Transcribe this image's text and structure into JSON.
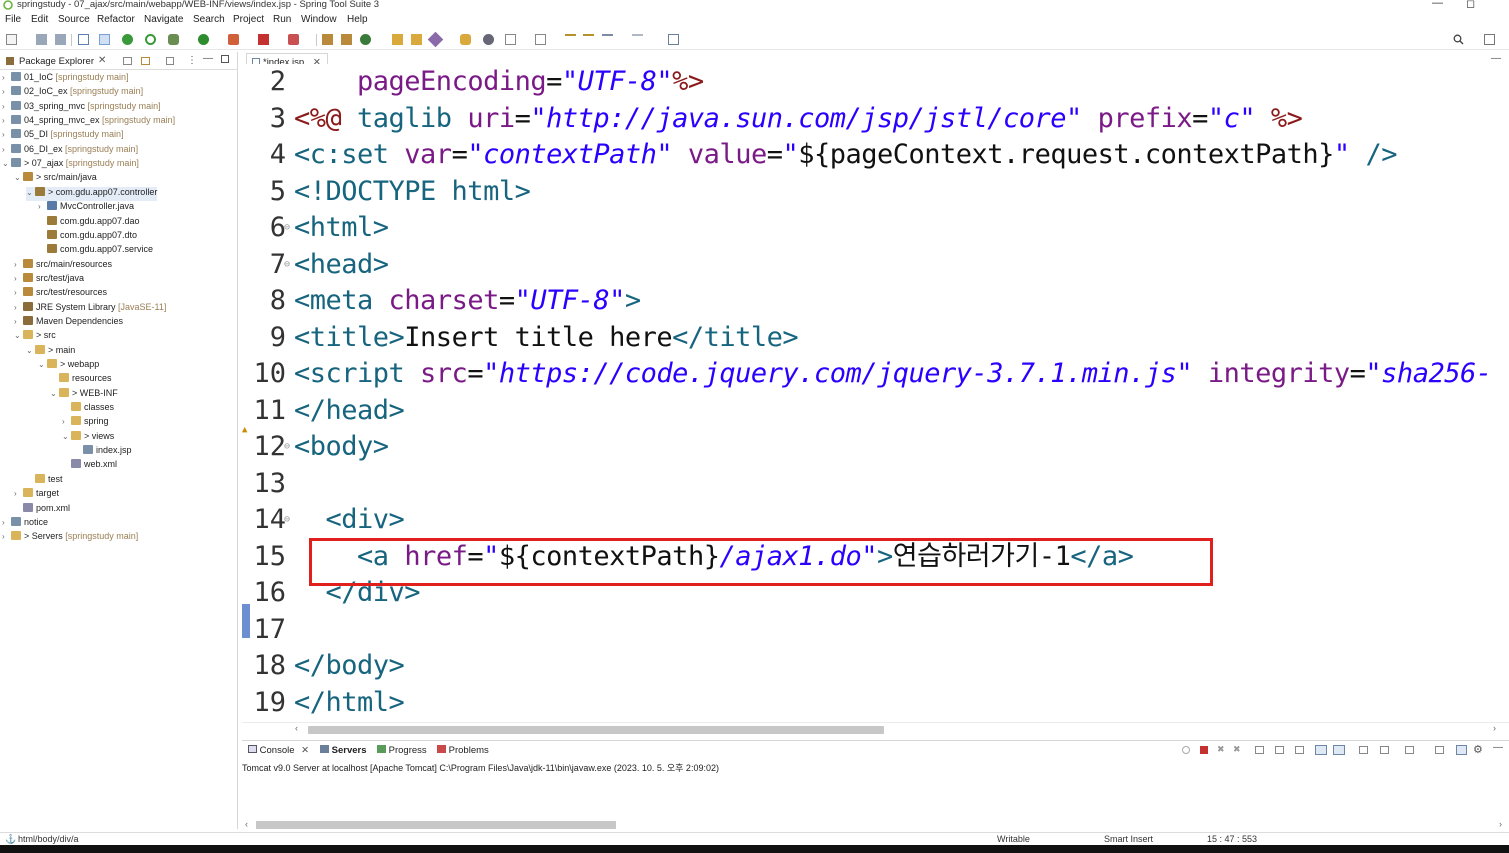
{
  "window": {
    "title": "springstudy - 07_ajax/src/main/webapp/WEB-INF/views/index.jsp - Spring Tool Suite 3",
    "minimize": "—",
    "maximize": "◻"
  },
  "menu": [
    "File",
    "Edit",
    "Source",
    "Refactor",
    "Navigate",
    "Search",
    "Project",
    "Run",
    "Window",
    "Help"
  ],
  "explorer": {
    "title": "Package Explorer",
    "close": "✕",
    "items": [
      {
        "label": "01_IoC",
        "meta": "[springstudy main]",
        "icon": "project-icon"
      },
      {
        "label": "02_IoC_ex",
        "meta": "[springstudy main]",
        "icon": "project-icon"
      },
      {
        "label": "03_spring_mvc",
        "meta": "[springstudy main]",
        "icon": "project-icon"
      },
      {
        "label": "04_spring_mvc_ex",
        "meta": "[springstudy main]",
        "icon": "project-icon"
      },
      {
        "label": "05_DI",
        "meta": "[springstudy main]",
        "icon": "project-icon"
      },
      {
        "label": "06_DI_ex",
        "meta": "[springstudy main]",
        "icon": "project-icon"
      },
      {
        "label": "> 07_ajax",
        "meta": "[springstudy main]",
        "icon": "project-icon"
      },
      {
        "label": "> src/main/java",
        "meta": "",
        "icon": "source-folder-icon"
      },
      {
        "label": "> com.gdu.app07.controller",
        "meta": "",
        "icon": "package-icon"
      },
      {
        "label": "MvcController.java",
        "meta": "",
        "icon": "java-file-icon"
      },
      {
        "label": "com.gdu.app07.dao",
        "meta": "",
        "icon": "package-icon"
      },
      {
        "label": "com.gdu.app07.dto",
        "meta": "",
        "icon": "package-icon"
      },
      {
        "label": "com.gdu.app07.service",
        "meta": "",
        "icon": "package-icon"
      },
      {
        "label": "src/main/resources",
        "meta": "",
        "icon": "source-folder-icon"
      },
      {
        "label": "src/test/java",
        "meta": "",
        "icon": "source-folder-icon"
      },
      {
        "label": "src/test/resources",
        "meta": "",
        "icon": "source-folder-icon"
      },
      {
        "label": "JRE System Library",
        "meta": "[JavaSE-11]",
        "icon": "library-icon"
      },
      {
        "label": "Maven Dependencies",
        "meta": "",
        "icon": "library-icon"
      },
      {
        "label": "> src",
        "meta": "",
        "icon": "folder-icon"
      },
      {
        "label": "> main",
        "meta": "",
        "icon": "folder-icon"
      },
      {
        "label": "> webapp",
        "meta": "",
        "icon": "folder-icon"
      },
      {
        "label": "resources",
        "meta": "",
        "icon": "folder-icon"
      },
      {
        "label": "> WEB-INF",
        "meta": "",
        "icon": "folder-icon"
      },
      {
        "label": "classes",
        "meta": "",
        "icon": "folder-icon"
      },
      {
        "label": "spring",
        "meta": "",
        "icon": "folder-icon"
      },
      {
        "label": "> views",
        "meta": "",
        "icon": "folder-icon"
      },
      {
        "label": "index.jsp",
        "meta": "",
        "icon": "jsp-file-icon"
      },
      {
        "label": "web.xml",
        "meta": "",
        "icon": "xml-file-icon"
      },
      {
        "label": "test",
        "meta": "",
        "icon": "folder-icon"
      },
      {
        "label": "target",
        "meta": "",
        "icon": "folder-icon"
      },
      {
        "label": "pom.xml",
        "meta": "",
        "icon": "xml-file-icon"
      },
      {
        "label": "notice",
        "meta": "",
        "icon": "project-icon"
      },
      {
        "label": "> Servers",
        "meta": "[springstudy main]",
        "icon": "folder-icon"
      }
    ]
  },
  "editor": {
    "tab_label": "*index.jsp",
    "tab_close": "✕",
    "lines": [
      {
        "num": "2",
        "parts": [
          {
            "t": "    ",
            "c": "plain"
          },
          {
            "t": "pageEncoding",
            "c": "attr"
          },
          {
            "t": "=",
            "c": "plain"
          },
          {
            "t": "\"UTF-8\"",
            "c": "str"
          },
          {
            "t": "%>",
            "c": "dir"
          }
        ]
      },
      {
        "num": "3",
        "parts": [
          {
            "t": "<%@ ",
            "c": "dir"
          },
          {
            "t": "taglib ",
            "c": "tag"
          },
          {
            "t": "uri",
            "c": "attr"
          },
          {
            "t": "=",
            "c": "plain"
          },
          {
            "t": "\"http://java.sun.com/jsp/jstl/core\" ",
            "c": "str"
          },
          {
            "t": "prefix",
            "c": "attr"
          },
          {
            "t": "=",
            "c": "plain"
          },
          {
            "t": "\"c\" ",
            "c": "str"
          },
          {
            "t": "%>",
            "c": "dir"
          }
        ]
      },
      {
        "num": "4",
        "parts": [
          {
            "t": "<c:set ",
            "c": "tag"
          },
          {
            "t": "var",
            "c": "attr"
          },
          {
            "t": "=",
            "c": "plain"
          },
          {
            "t": "\"contextPath\" ",
            "c": "str"
          },
          {
            "t": "value",
            "c": "attr"
          },
          {
            "t": "=",
            "c": "plain"
          },
          {
            "t": "\"",
            "c": "str"
          },
          {
            "t": "${pageContext.request.contextPath}",
            "c": "plain"
          },
          {
            "t": "\" ",
            "c": "str"
          },
          {
            "t": "/>",
            "c": "tag"
          }
        ]
      },
      {
        "num": "5",
        "parts": [
          {
            "t": "<!DOCTYPE html>",
            "c": "tag"
          }
        ]
      },
      {
        "num": "6",
        "parts": [
          {
            "t": "<html>",
            "c": "tag"
          }
        ]
      },
      {
        "num": "7",
        "parts": [
          {
            "t": "<head>",
            "c": "tag"
          }
        ]
      },
      {
        "num": "8",
        "parts": [
          {
            "t": "<meta ",
            "c": "tag"
          },
          {
            "t": "charset",
            "c": "attr"
          },
          {
            "t": "=",
            "c": "plain"
          },
          {
            "t": "\"UTF-8\"",
            "c": "str"
          },
          {
            "t": ">",
            "c": "tag"
          }
        ]
      },
      {
        "num": "9",
        "parts": [
          {
            "t": "<title>",
            "c": "tag"
          },
          {
            "t": "Insert title here",
            "c": "plain"
          },
          {
            "t": "</title>",
            "c": "tag"
          }
        ]
      },
      {
        "num": "10",
        "parts": [
          {
            "t": "<script ",
            "c": "tag"
          },
          {
            "t": "src",
            "c": "attr"
          },
          {
            "t": "=",
            "c": "plain"
          },
          {
            "t": "\"https://code.jquery.com/jquery-3.7.1.min.js\" ",
            "c": "str"
          },
          {
            "t": "integrity",
            "c": "attr"
          },
          {
            "t": "=",
            "c": "plain"
          },
          {
            "t": "\"sha256-",
            "c": "str"
          }
        ]
      },
      {
        "num": "11",
        "parts": [
          {
            "t": "</head>",
            "c": "tag"
          }
        ]
      },
      {
        "num": "12",
        "parts": [
          {
            "t": "<body>",
            "c": "tag"
          }
        ]
      },
      {
        "num": "13",
        "parts": []
      },
      {
        "num": "14",
        "parts": [
          {
            "t": "  ",
            "c": "plain"
          },
          {
            "t": "<div>",
            "c": "tag"
          }
        ]
      },
      {
        "num": "15",
        "parts": [
          {
            "t": "    ",
            "c": "plain"
          },
          {
            "t": "<a ",
            "c": "tag"
          },
          {
            "t": "href",
            "c": "attr"
          },
          {
            "t": "=",
            "c": "plain"
          },
          {
            "t": "\"",
            "c": "str"
          },
          {
            "t": "${contextPath}",
            "c": "plain"
          },
          {
            "t": "/ajax1.do\"",
            "c": "str"
          },
          {
            "t": ">",
            "c": "tag"
          },
          {
            "t": "연습하러가기-1",
            "c": "plain"
          },
          {
            "t": "</a>",
            "c": "tag"
          }
        ]
      },
      {
        "num": "16",
        "parts": [
          {
            "t": "  ",
            "c": "plain"
          },
          {
            "t": "</div>",
            "c": "tag"
          }
        ]
      },
      {
        "num": "17",
        "parts": []
      },
      {
        "num": "18",
        "parts": [
          {
            "t": "</body>",
            "c": "tag"
          }
        ]
      },
      {
        "num": "19",
        "parts": [
          {
            "t": "</html>",
            "c": "tag"
          }
        ]
      }
    ]
  },
  "console": {
    "tabs": [
      {
        "label": "Console",
        "bold": false
      },
      {
        "label": "Servers",
        "bold": true
      },
      {
        "label": "Progress",
        "bold": false
      },
      {
        "label": "Problems",
        "bold": false
      }
    ],
    "output": "Tomcat v9.0 Server at localhost [Apache Tomcat] C:\\Program Files\\Java\\jdk-11\\bin\\javaw.exe  (2023. 10. 5. 오후 2:09:02)"
  },
  "status": {
    "path": "html/body/div/a",
    "writable": "Writable",
    "insert_mode": "Smart Insert",
    "position": "15 : 47 : 553"
  },
  "colors": {
    "highlight_box": "#e0201c",
    "tag": "#17647f",
    "attribute": "#7a1a86",
    "string": "#2a00ff"
  }
}
